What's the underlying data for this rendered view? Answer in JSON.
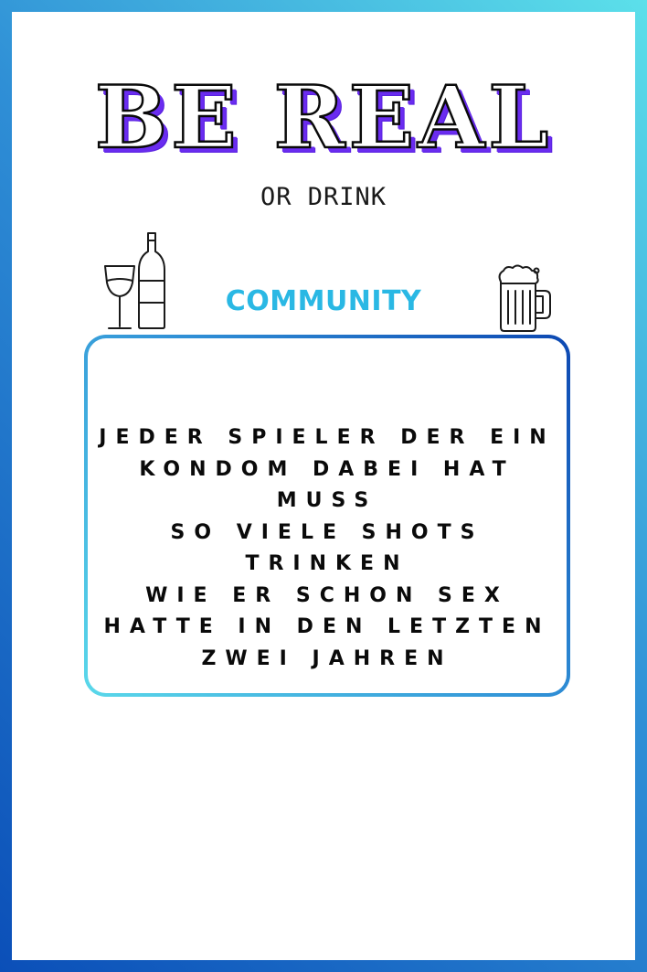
{
  "title": "BE REAL",
  "subtitle": "OR DRINK",
  "category": "COMMUNITY",
  "icons": {
    "left": "wine-glass-and-bottle-icon",
    "right": "beer-mug-icon"
  },
  "card_text": "JEDER SPIELER DER EIN\nKONDOM DABEI HAT MUSS\nSO VIELE SHOTS TRINKEN\nWIE ER SCHON SEX\nHATTE IN DEN LETZTEN\nZWEI JAHREN",
  "colors": {
    "title_shadow": "#6a2cf0",
    "category": "#2ab8e4",
    "frame_light": "#5ce0ea",
    "frame_dark": "#0b4fb8"
  }
}
